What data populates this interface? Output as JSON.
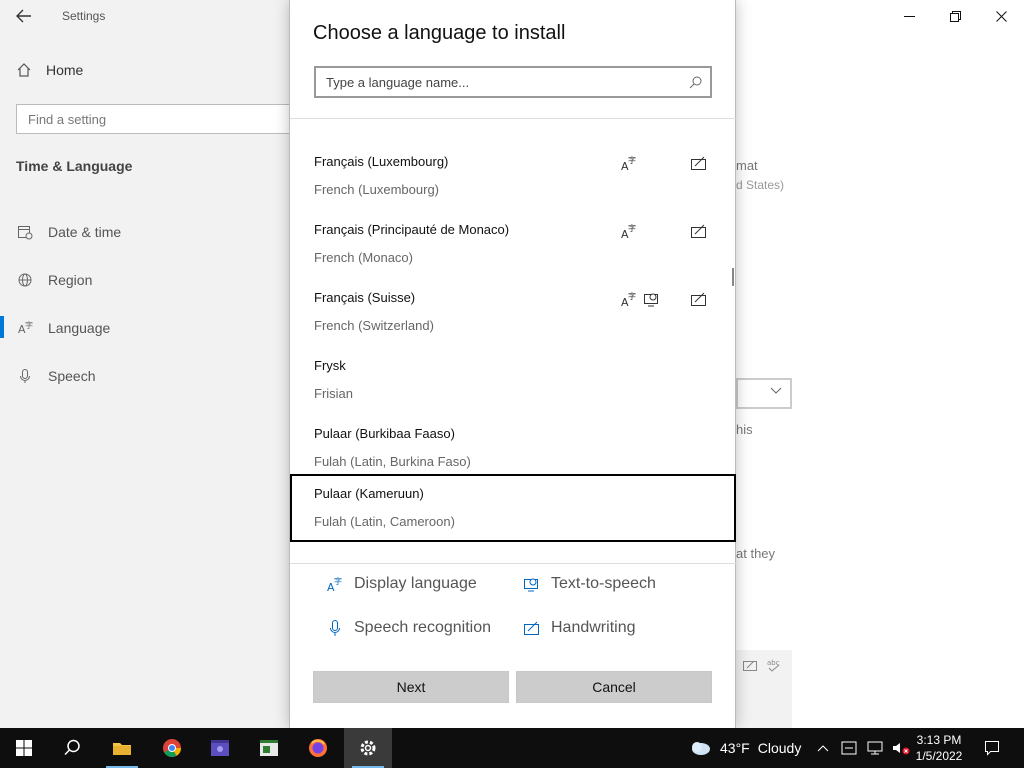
{
  "settings": {
    "window_title": "Settings",
    "home_label": "Home",
    "search_placeholder": "Find a setting",
    "section_title": "Time & Language",
    "nav": [
      {
        "label": "Date & time",
        "icon": "calendar-clock-icon"
      },
      {
        "label": "Region",
        "icon": "globe-icon"
      },
      {
        "label": "Language",
        "icon": "language-icon",
        "selected": true
      },
      {
        "label": "Speech",
        "icon": "microphone-icon"
      }
    ],
    "right_pane": {
      "frag_format": "mat",
      "frag_states": "d States)",
      "frag_this": "his",
      "frag_they": "at they"
    }
  },
  "dialog": {
    "title": "Choose a language to install",
    "search_placeholder": "Type a language name...",
    "languages": [
      {
        "name": "Français (Luxembourg)",
        "english": "French (Luxembourg)",
        "features": [
          "display",
          "handwriting"
        ]
      },
      {
        "name": "Français (Principauté de Monaco)",
        "english": "French (Monaco)",
        "features": [
          "display",
          "handwriting"
        ]
      },
      {
        "name": "Français (Suisse)",
        "english": "French (Switzerland)",
        "features": [
          "display",
          "tts",
          "handwriting"
        ]
      },
      {
        "name": "Frysk",
        "english": "Frisian",
        "features": []
      },
      {
        "name": "Pulaar (Burkibaa Faaso)",
        "english": "Fulah (Latin, Burkina Faso)",
        "features": []
      },
      {
        "name": "Pulaar (Kameruun)",
        "english": "Fulah (Latin, Cameroon)",
        "features": [],
        "selected": true
      }
    ],
    "legend": {
      "display": "Display language",
      "tts": "Text-to-speech",
      "speech": "Speech recognition",
      "handwriting": "Handwriting"
    },
    "next_label": "Next",
    "cancel_label": "Cancel"
  },
  "taskbar": {
    "weather_temp": "43°F",
    "weather_cond": "Cloudy",
    "time": "3:13 PM",
    "date": "1/5/2022"
  }
}
